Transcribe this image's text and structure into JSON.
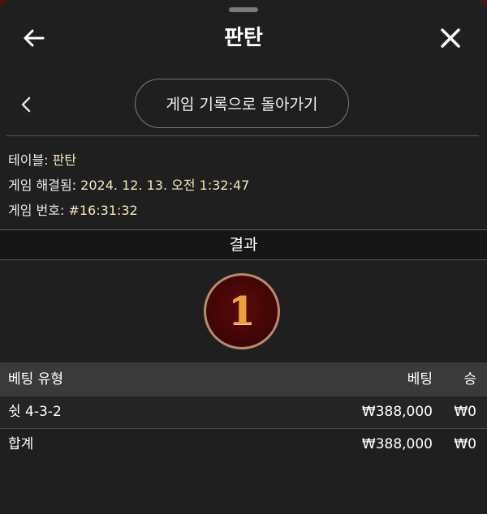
{
  "header": {
    "title": "판탄",
    "back_icon": "arrow-left-icon",
    "close_icon": "close-icon"
  },
  "nav": {
    "chevron_icon": "chevron-left-icon",
    "history_button": "게임 기록으로 돌아가기"
  },
  "info": {
    "table_label": "테이블: ",
    "table_value": "판탄",
    "resolved_label": "게임 해결됨: ",
    "resolved_value": "2024. 12. 13. 오전 1:32:47",
    "game_no_label": "게임 번호: ",
    "game_no_value": "#16:31:32"
  },
  "result": {
    "label": "결과",
    "number": "1",
    "ball_color": "#3e0505",
    "number_color": "#e9a33a"
  },
  "table": {
    "headers": {
      "type": "베팅 유형",
      "bet": "베팅",
      "win": "승"
    },
    "rows": [
      {
        "type": "쉿 4-3-2",
        "bet": "₩388,000",
        "win": "₩0"
      }
    ],
    "total": {
      "type": "합계",
      "bet": "₩388,000",
      "win": "₩0"
    }
  },
  "colors": {
    "background": "#1f1f1f",
    "accent_value": "#f3e6b8",
    "outer_backdrop": "#4a1414"
  }
}
